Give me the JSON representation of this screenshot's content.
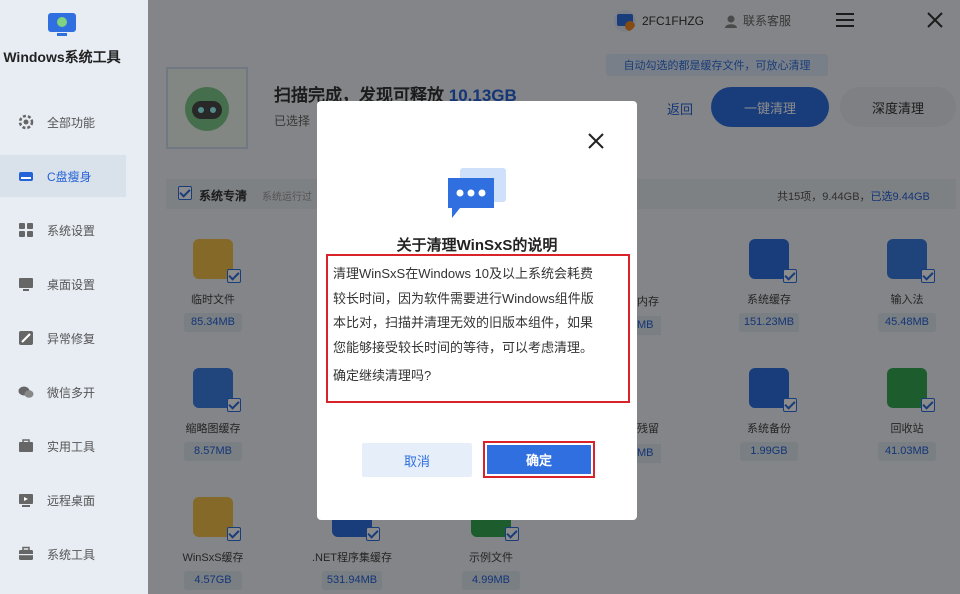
{
  "app": {
    "title": "Windows系统工具"
  },
  "sidebar": {
    "items": [
      {
        "label": "全部功能",
        "icon": "gear-icon"
      },
      {
        "label": "C盘瘦身",
        "icon": "disk-icon",
        "active": true
      },
      {
        "label": "系统设置",
        "icon": "grid-icon"
      },
      {
        "label": "桌面设置",
        "icon": "monitor-icon"
      },
      {
        "label": "异常修复",
        "icon": "wrench-icon"
      },
      {
        "label": "微信多开",
        "icon": "chat-icon"
      },
      {
        "label": "实用工具",
        "icon": "toolbox-icon"
      },
      {
        "label": "远程桌面",
        "icon": "remote-icon"
      },
      {
        "label": "系统工具",
        "icon": "briefcase-icon"
      }
    ]
  },
  "header": {
    "user_id": "2FC1FHZG",
    "support_label": "联系客服",
    "tip": "自动勾选的都是缓存文件，可放心清理"
  },
  "scan": {
    "title_prefix": "扫描完成，发现可释放",
    "size": "10.13GB",
    "subtitle": "已选择",
    "back_label": "返回",
    "primary_label": "一键清理",
    "secondary_label": "深度清理"
  },
  "section": {
    "title": "系统专清",
    "subtitle": "系统运行过",
    "total": "共15项，9.44GB，",
    "selected": "已选9.44GB"
  },
  "items": [
    {
      "name": "临时文件",
      "size": "85.34MB",
      "color": "#f0c049"
    },
    {
      "name": "系统缓存",
      "size": "151.23MB",
      "color": "#2f6fe0"
    },
    {
      "name": "输入法",
      "size": "45.48MB",
      "color": "#3a7be0"
    },
    {
      "name": "缩略图缓存",
      "size": "8.57MB",
      "color": "#3d7ee4"
    },
    {
      "name": "系统备份",
      "size": "1.99GB",
      "color": "#2f6fe0"
    },
    {
      "name": "回收站",
      "size": "41.03MB",
      "color": "#34a853"
    },
    {
      "name": "WinSxS缓存",
      "size": "4.57GB",
      "color": "#f0c049"
    },
    {
      "name": ".NET程序集缓存",
      "size": "531.94MB",
      "color": "#2f6fe0"
    },
    {
      "name": "示例文件",
      "size": "4.99MB",
      "color": "#34a853"
    }
  ],
  "partial": {
    "a": "内存",
    "b": "MB",
    "c": "残留",
    "d": "MB"
  },
  "dialog": {
    "title": "关于清理WinSxS的说明",
    "lines": [
      "清理WinSxS在Windows 10及以上系统会耗费",
      "较长时间，因为软件需要进行Windows组件版",
      "本比对，扫描并清理无效的旧版本组件，如果",
      "您能够接受较长时间的等待，可以考虑清理。"
    ],
    "question": "确定继续清理吗?",
    "cancel_label": "取消",
    "ok_label": "确定"
  }
}
